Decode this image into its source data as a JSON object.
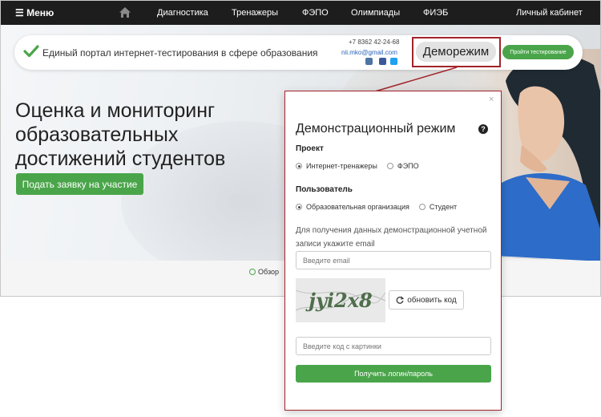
{
  "nav": {
    "menu_label": "☰ Меню",
    "items": [
      {
        "label": "Диагностика"
      },
      {
        "label": "Тренажеры"
      },
      {
        "label": "ФЭПО"
      },
      {
        "label": "Олимпиады"
      },
      {
        "label": "ФИЭБ"
      },
      {
        "label": "Личный кабинет"
      }
    ]
  },
  "banner": {
    "text": "Единый портал интернет-тестирования в сфере образования",
    "phone": "+7 8362 42-24-68",
    "email": "nii.mko@gmail.com",
    "demo_label": "Деморежим",
    "test_label": "Пройти тестирование"
  },
  "hero": {
    "title": "Оценка и мониторинг образовательных достижений студентов",
    "apply_label": "Подать заявку на участие",
    "overview_label": "Обзор"
  },
  "modal": {
    "close": "×",
    "title": "Демонстрационный режим",
    "help": "?",
    "project_label": "Проект",
    "project_options": [
      {
        "label": "Интернет-тренажеры",
        "checked": true
      },
      {
        "label": "ФЭПО",
        "checked": false
      }
    ],
    "user_label": "Пользователь",
    "user_options": [
      {
        "label": "Образовательная организация",
        "checked": true
      },
      {
        "label": "Студент",
        "checked": false
      }
    ],
    "hint": "Для получения данных демонстрационной учетной записи укажите email",
    "email_placeholder": "Введите email",
    "captcha_text": "jyi2x8",
    "refresh_label": "обновить код",
    "code_placeholder": "Введите код с картинки",
    "submit_label": "Получить логин/пароль"
  },
  "colors": {
    "accent_green": "#4aa54a",
    "highlight_red": "#a2242a",
    "nav_bg": "#1d1d1d"
  }
}
